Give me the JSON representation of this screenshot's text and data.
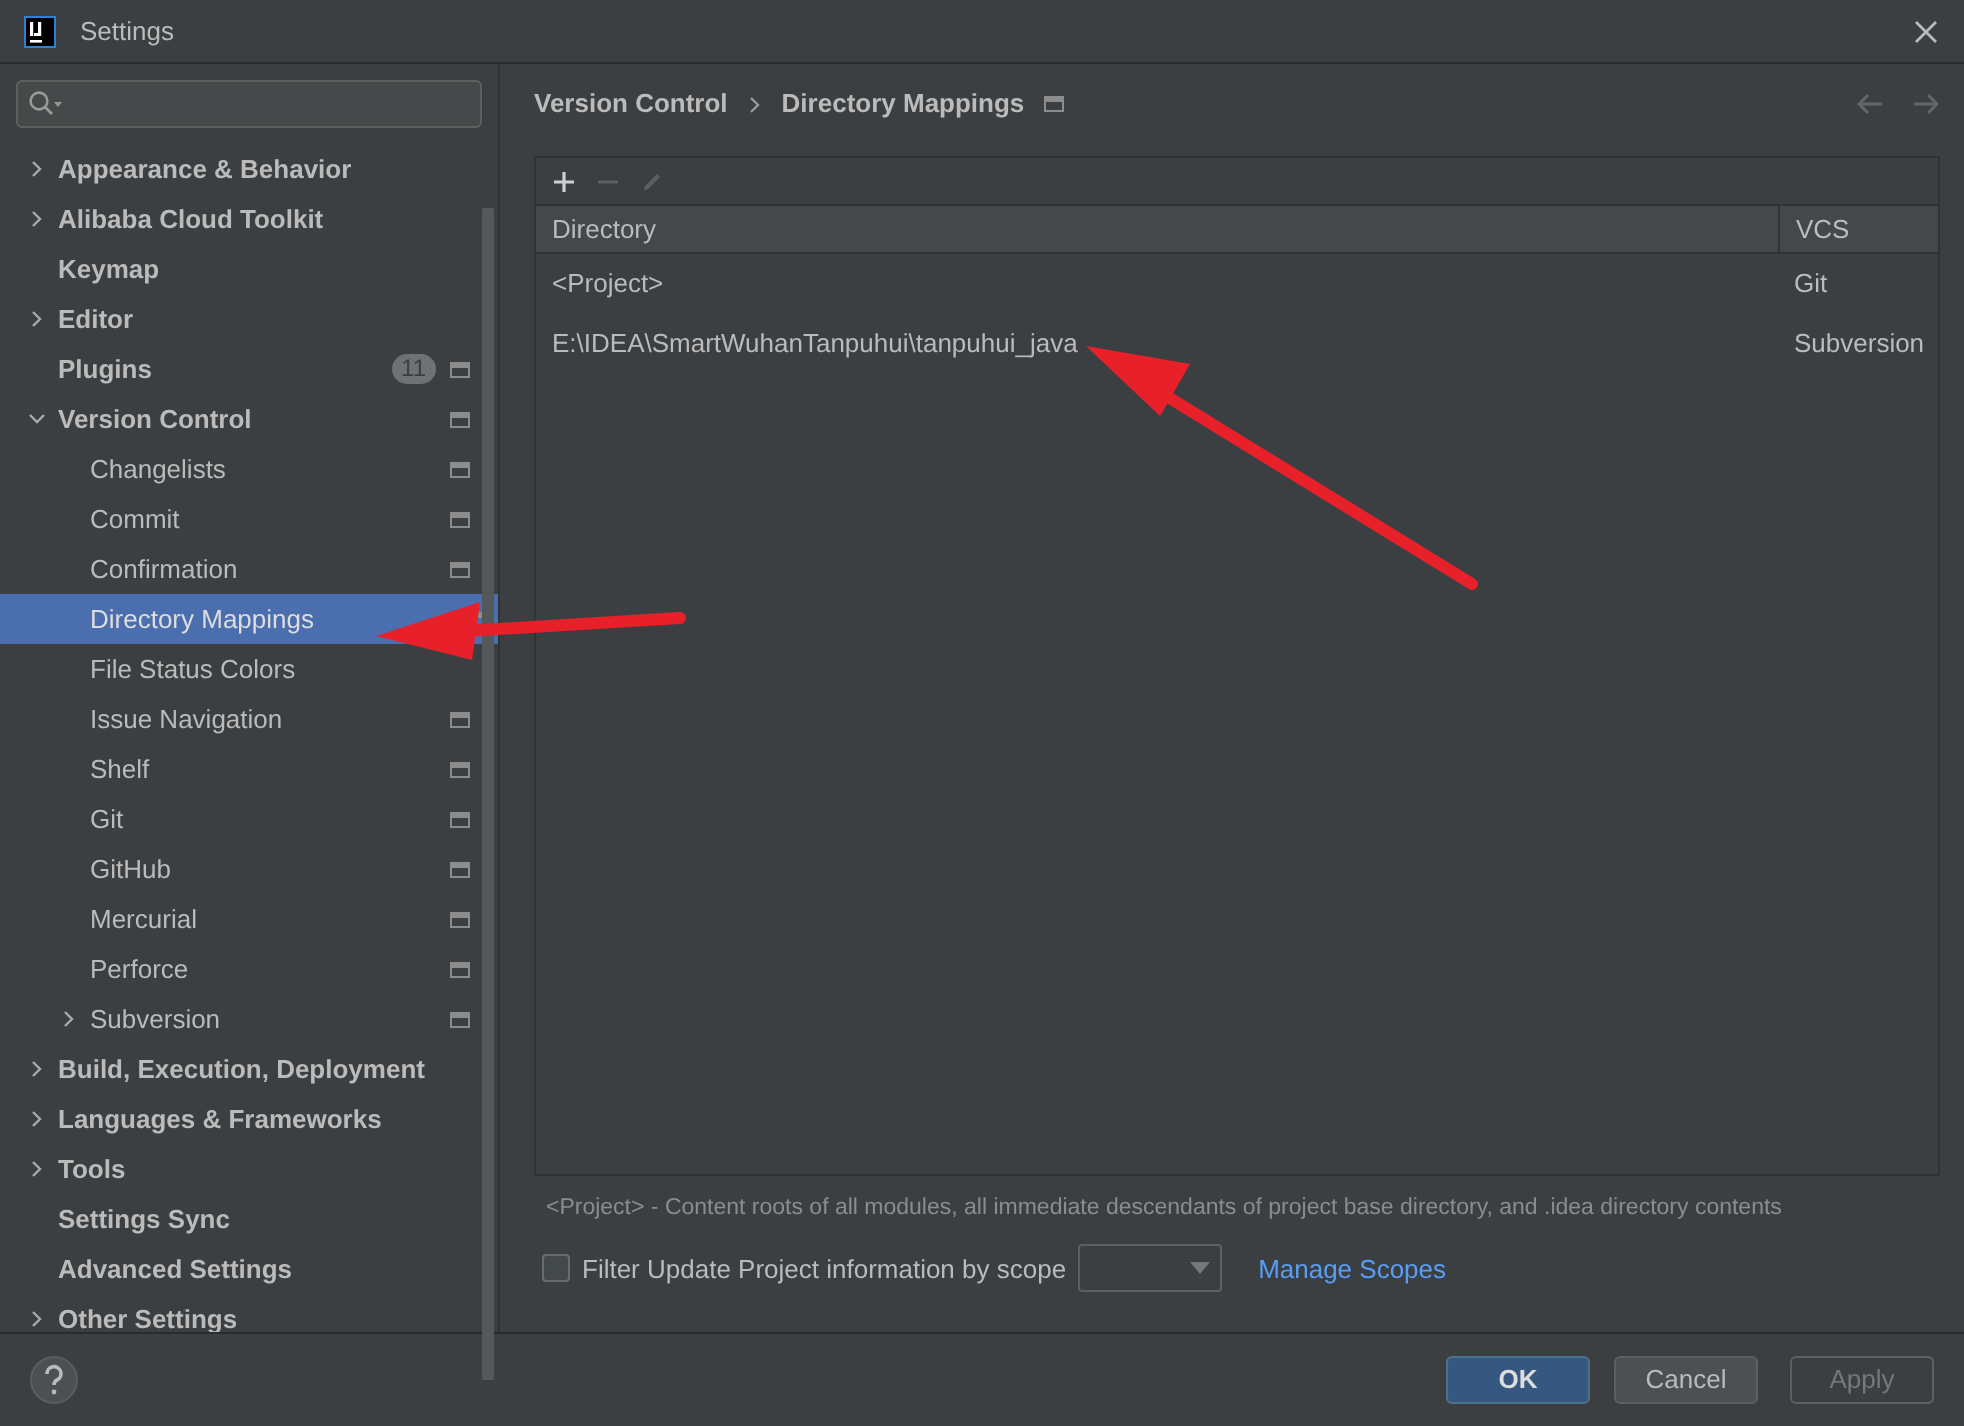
{
  "window": {
    "title": "Settings"
  },
  "sidebar": {
    "items": [
      {
        "label": "Appearance & Behavior",
        "expanded": false,
        "selected": false,
        "project_scoped": false
      },
      {
        "label": "Alibaba Cloud Toolkit",
        "expanded": false,
        "selected": false,
        "project_scoped": false
      },
      {
        "label": "Keymap",
        "selected": false,
        "project_scoped": false
      },
      {
        "label": "Editor",
        "expanded": false,
        "selected": false,
        "project_scoped": false
      },
      {
        "label": "Plugins",
        "badge": "11",
        "selected": false,
        "project_scoped": true
      },
      {
        "label": "Version Control",
        "expanded": true,
        "selected": false,
        "project_scoped": true,
        "children": [
          {
            "label": "Changelists",
            "selected": false,
            "project_scoped": true
          },
          {
            "label": "Commit",
            "selected": false,
            "project_scoped": true
          },
          {
            "label": "Confirmation",
            "selected": false,
            "project_scoped": true
          },
          {
            "label": "Directory Mappings",
            "selected": true,
            "project_scoped": true
          },
          {
            "label": "File Status Colors",
            "selected": false,
            "project_scoped": false
          },
          {
            "label": "Issue Navigation",
            "selected": false,
            "project_scoped": true
          },
          {
            "label": "Shelf",
            "selected": false,
            "project_scoped": true
          },
          {
            "label": "Git",
            "selected": false,
            "project_scoped": true
          },
          {
            "label": "GitHub",
            "selected": false,
            "project_scoped": true
          },
          {
            "label": "Mercurial",
            "selected": false,
            "project_scoped": true
          },
          {
            "label": "Perforce",
            "selected": false,
            "project_scoped": true
          },
          {
            "label": "Subversion",
            "expanded": false,
            "selected": false,
            "project_scoped": true
          }
        ]
      },
      {
        "label": "Build, Execution, Deployment",
        "expanded": false,
        "selected": false,
        "project_scoped": false
      },
      {
        "label": "Languages & Frameworks",
        "expanded": false,
        "selected": false,
        "project_scoped": false
      },
      {
        "label": "Tools",
        "expanded": false,
        "selected": false,
        "project_scoped": false
      },
      {
        "label": "Settings Sync",
        "selected": false,
        "project_scoped": false
      },
      {
        "label": "Advanced Settings",
        "selected": false,
        "project_scoped": false
      },
      {
        "label": "Other Settings",
        "expanded": false,
        "selected": false,
        "project_scoped": false
      }
    ]
  },
  "breadcrumb": [
    "Version Control",
    "Directory Mappings"
  ],
  "toolbar": [
    {
      "kind": "add",
      "disabled": false
    },
    {
      "kind": "remove",
      "disabled": true
    },
    {
      "kind": "edit",
      "disabled": true
    }
  ],
  "table": {
    "columns": [
      "Directory",
      "VCS"
    ],
    "rows": [
      [
        "<Project>",
        "Git"
      ],
      [
        "E:\\IDEA\\SmartWuhanTanpuhui\\tanpuhui_java",
        "Subversion"
      ]
    ]
  },
  "note": "<Project> - Content roots of all modules, all immediate descendants of project base directory, and .idea directory contents",
  "filter": {
    "label": "Filter Update Project information by scope",
    "checked": false,
    "link": "Manage Scopes"
  },
  "buttons": [
    {
      "label": "OK",
      "kind": "primary",
      "disabled": false
    },
    {
      "label": "Cancel",
      "kind": "normal",
      "disabled": false
    },
    {
      "label": "Apply",
      "kind": "normal",
      "disabled": true
    }
  ]
}
